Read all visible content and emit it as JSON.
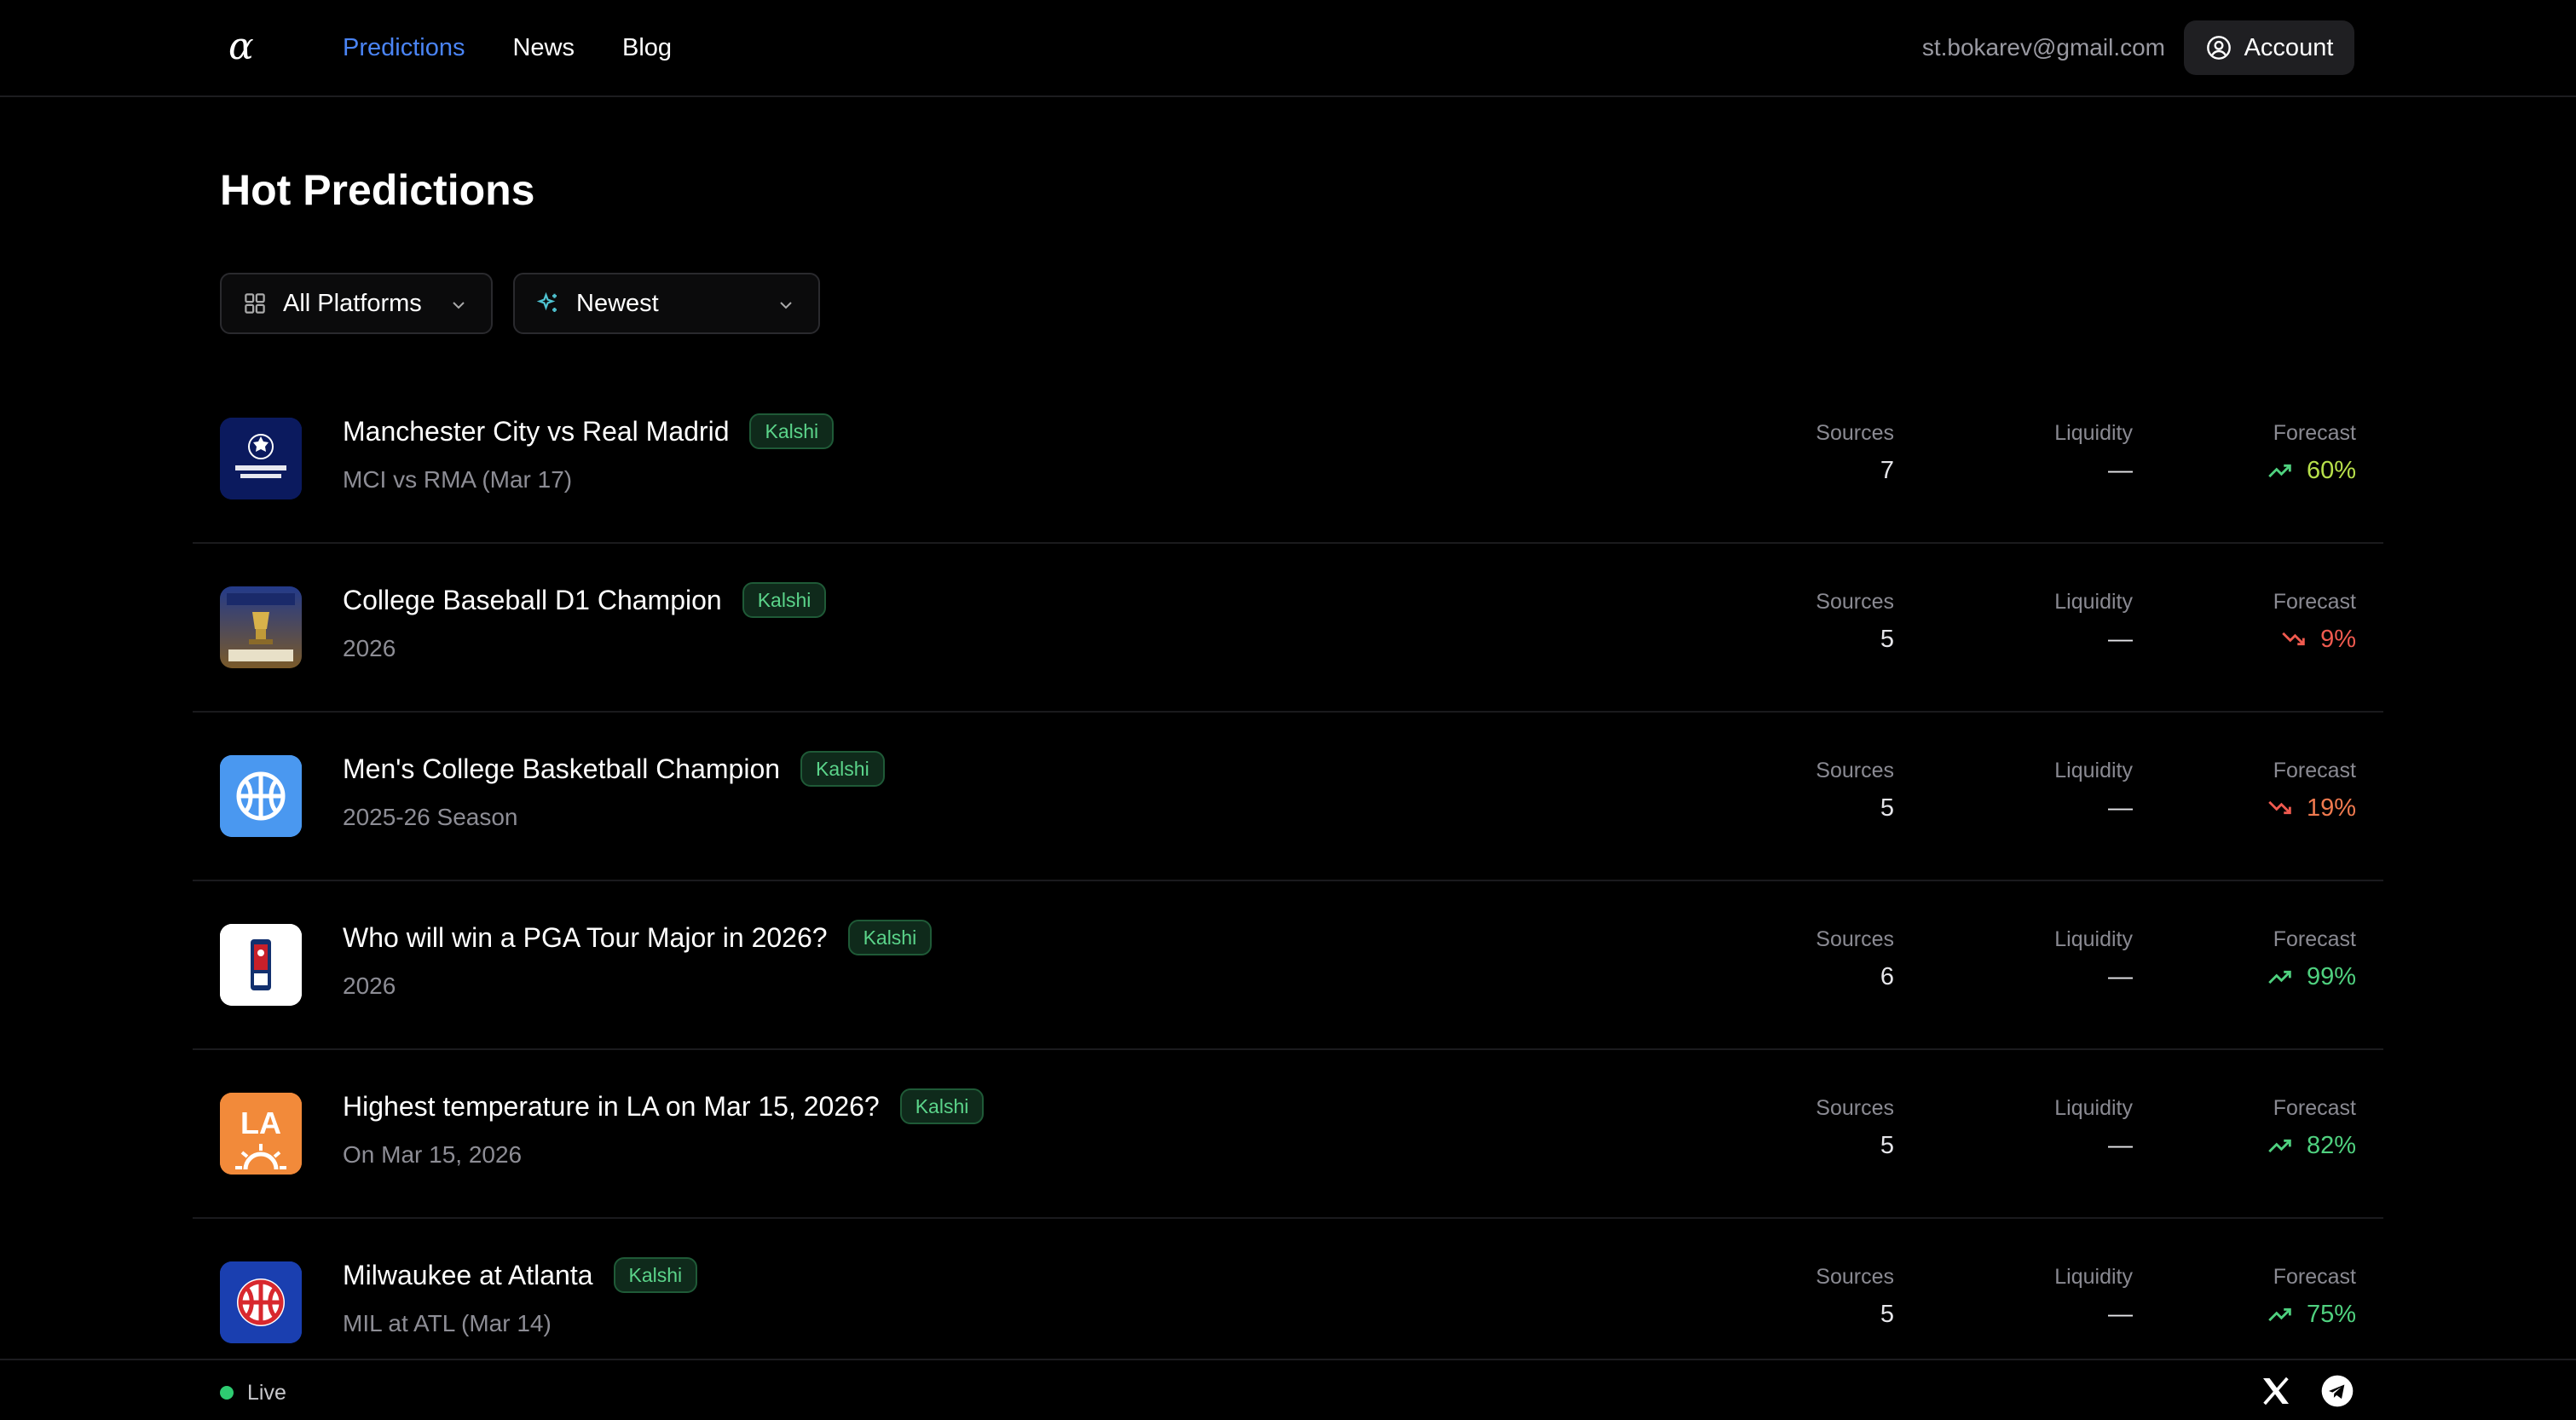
{
  "header": {
    "logo": "α",
    "nav": [
      {
        "label": "Predictions",
        "active": true
      },
      {
        "label": "News",
        "active": false
      },
      {
        "label": "Blog",
        "active": false
      }
    ],
    "email": "st.bokarev@gmail.com",
    "account_label": "Account"
  },
  "page_title": "Hot Predictions",
  "filters": {
    "platform": "All Platforms",
    "sort": "Newest"
  },
  "columns": {
    "sources": "Sources",
    "liquidity": "Liquidity",
    "forecast": "Forecast"
  },
  "rows": [
    {
      "title": "Manchester City vs Real Madrid",
      "badge": "Kalshi",
      "subtitle": "MCI vs RMA (Mar 17)",
      "sources": "7",
      "liquidity": "—",
      "forecast": "60%",
      "trend": "up",
      "icon": "champions-league-icon",
      "color": "#b7e04a"
    },
    {
      "title": "College Baseball D1 Champion",
      "badge": "Kalshi",
      "subtitle": "2026",
      "sources": "5",
      "liquidity": "—",
      "forecast": "9%",
      "trend": "down",
      "icon": "world-series-trophy-icon",
      "color": "#f05a4f"
    },
    {
      "title": "Men's College Basketball Champion",
      "badge": "Kalshi",
      "subtitle": "2025-26 Season",
      "sources": "5",
      "liquidity": "—",
      "forecast": "19%",
      "trend": "down",
      "icon": "basketball-icon",
      "color": "#f07a4f"
    },
    {
      "title": "Who will win a PGA Tour Major in 2026?",
      "badge": "Kalshi",
      "subtitle": "2026",
      "sources": "6",
      "liquidity": "—",
      "forecast": "99%",
      "trend": "up",
      "icon": "pga-tour-icon",
      "color": "#4fd17f"
    },
    {
      "title": "Highest temperature in LA on Mar 15, 2026?",
      "badge": "Kalshi",
      "subtitle": "On Mar 15, 2026",
      "sources": "5",
      "liquidity": "—",
      "forecast": "82%",
      "trend": "up",
      "icon": "la-sun-icon",
      "color": "#4fd17f"
    },
    {
      "title": "Milwaukee at Atlanta",
      "badge": "Kalshi",
      "subtitle": "MIL at ATL (Mar 14)",
      "sources": "5",
      "liquidity": "—",
      "forecast": "75%",
      "trend": "up",
      "icon": "basketball-red-icon",
      "color": "#4fd17f"
    }
  ],
  "thumb_text": {
    "la": "LA"
  },
  "footer": {
    "status": "Live",
    "status_color": "#2ecc71"
  },
  "colors": {
    "accent": "#4a84f5",
    "badge_text": "#5bd48a",
    "up": "#4fd17f",
    "down": "#f05a4f"
  }
}
